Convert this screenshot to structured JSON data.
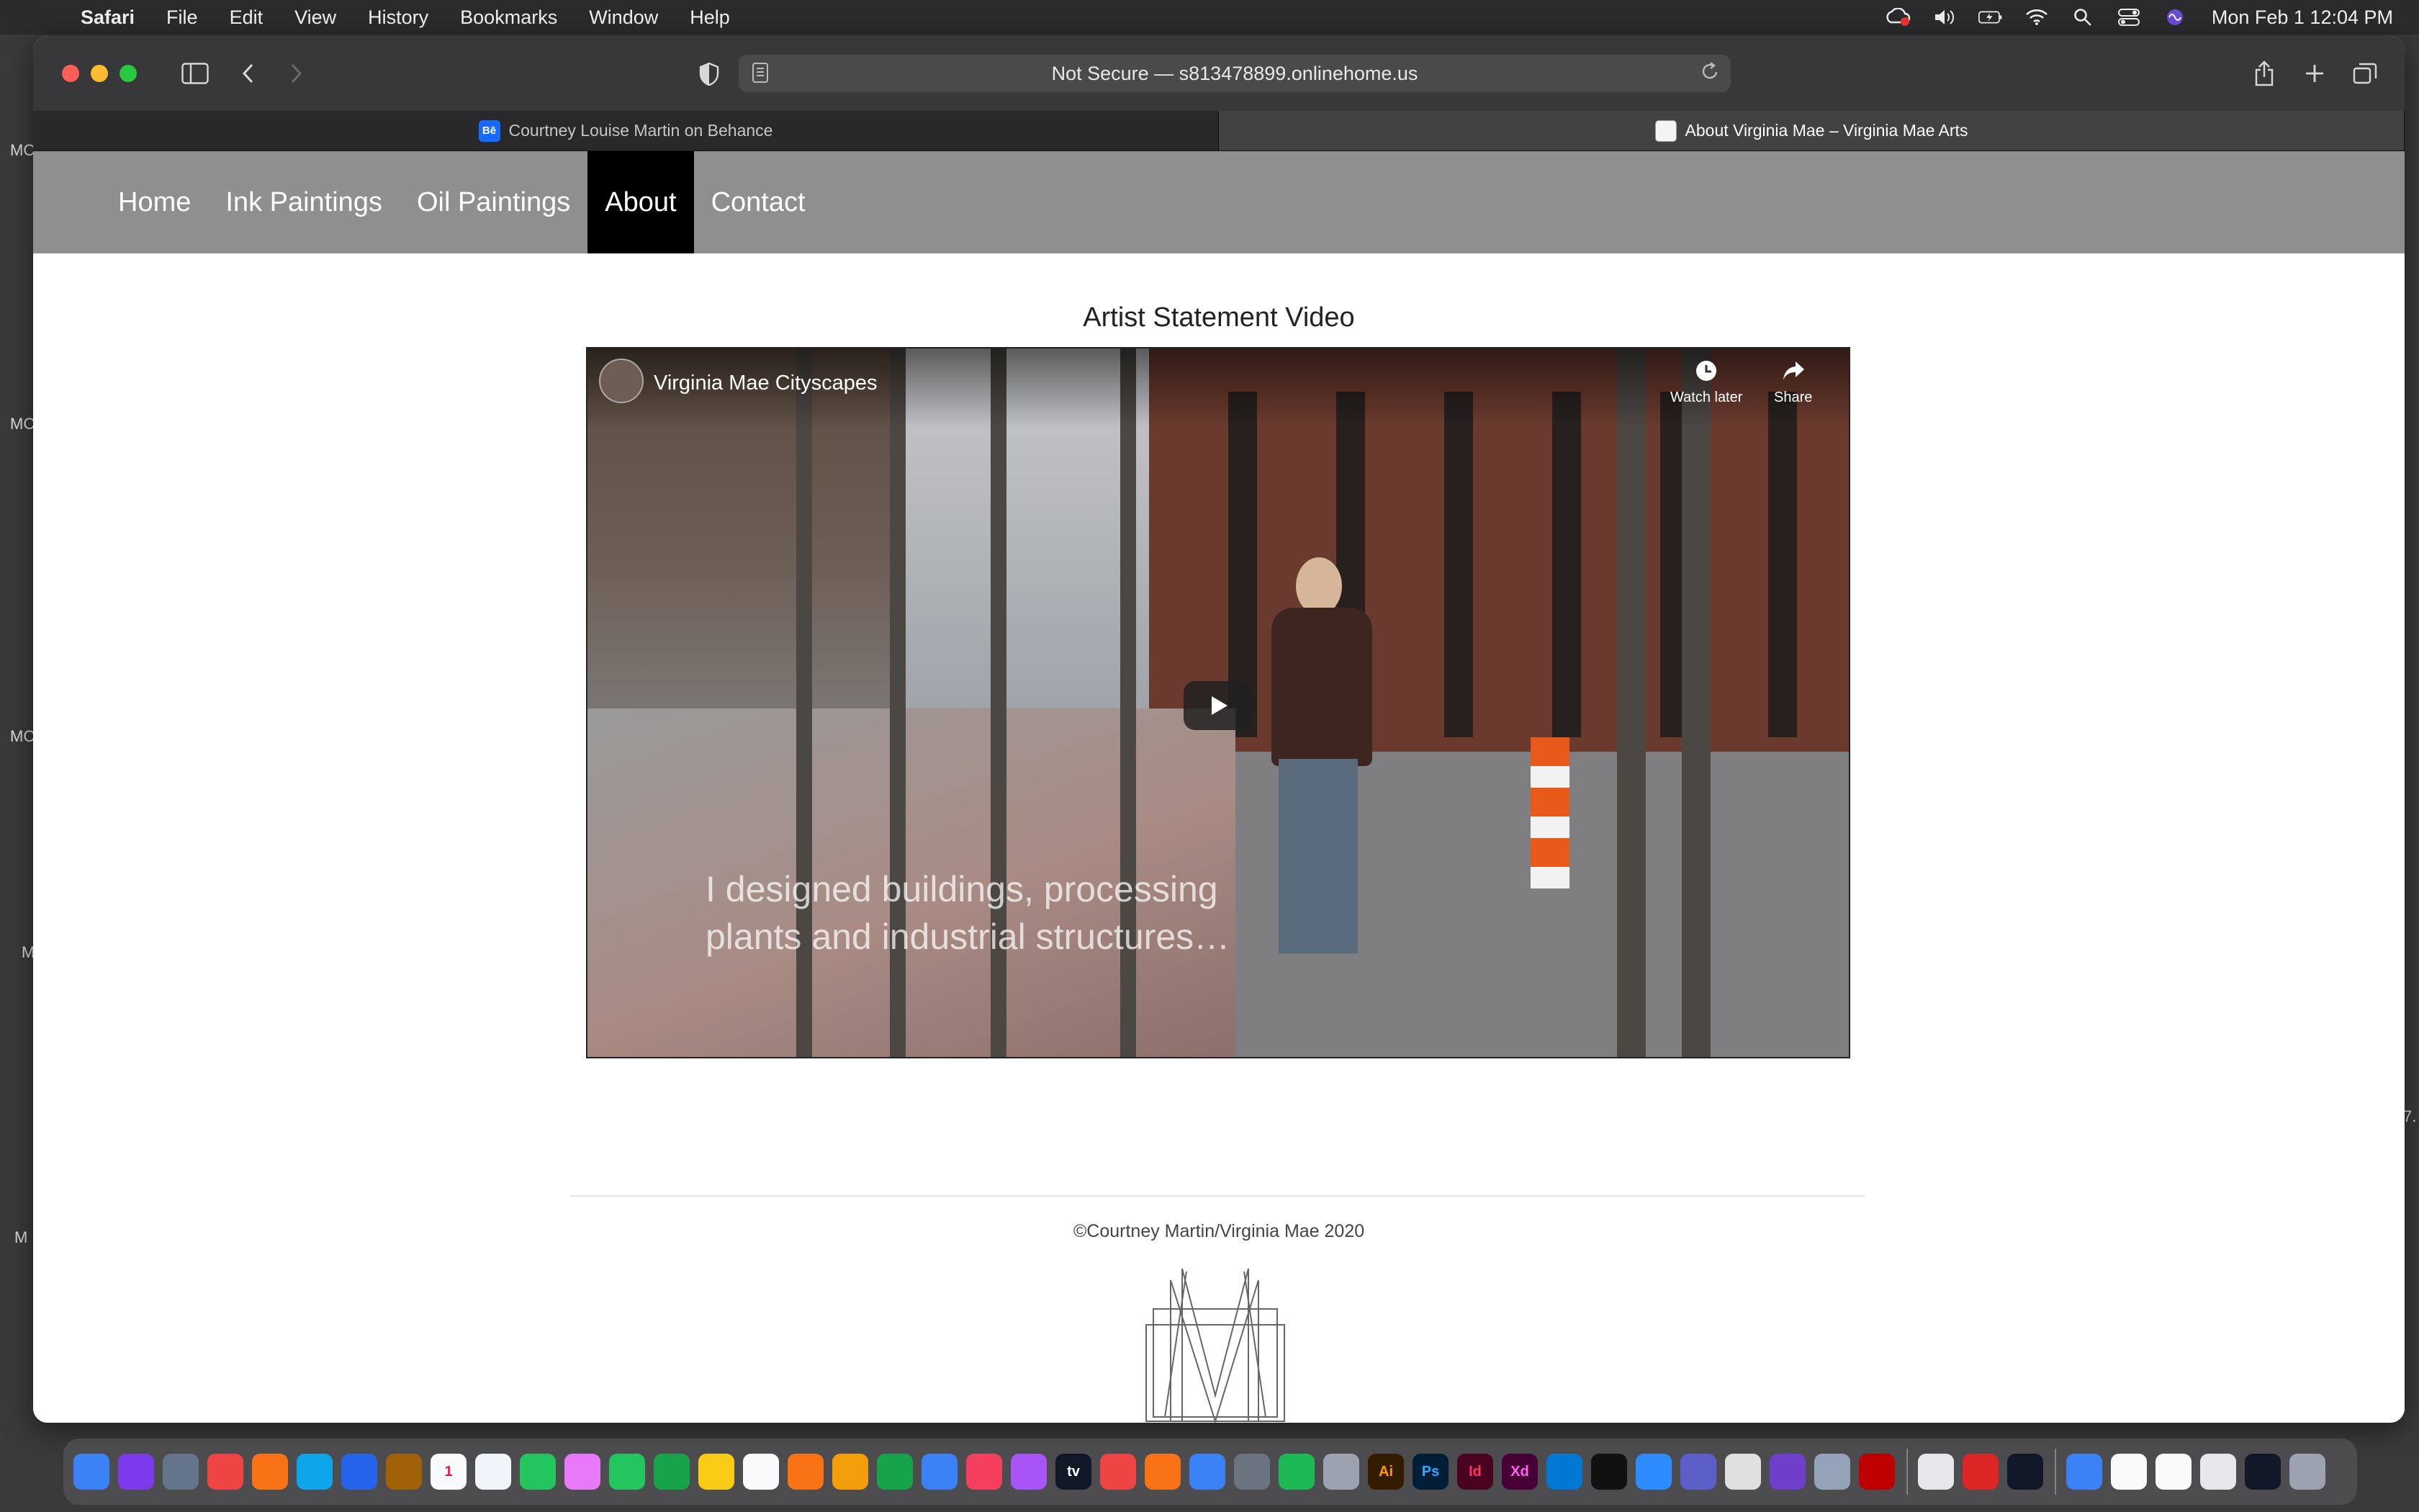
{
  "menubar": {
    "app_name": "Safari",
    "items": [
      "File",
      "Edit",
      "View",
      "History",
      "Bookmarks",
      "Window",
      "Help"
    ],
    "clock": "Mon Feb 1  12:04 PM"
  },
  "browser": {
    "address_text": "Not Secure — s813478899.onlinehome.us",
    "tabs": [
      {
        "label": "Courtney Louise Martin on Behance",
        "favicon_text": "Bē",
        "active": false
      },
      {
        "label": "About Virginia Mae – Virginia Mae Arts",
        "favicon_text": "",
        "active": true
      }
    ]
  },
  "site": {
    "nav": [
      "Home",
      "Ink Paintings",
      "Oil Paintings",
      "About",
      "Contact"
    ],
    "active_nav": "About",
    "section_title": "Artist Statement Video",
    "video": {
      "channel_title": "Virginia Mae Cityscapes",
      "watch_later_label": "Watch later",
      "share_label": "Share",
      "caption_line1": "I designed buildings, processing",
      "caption_line2": "plants and industrial structures…"
    },
    "copyright": "©Courtney Martin/Virginia Mae 2020"
  },
  "desktop_edge_labels": [
    "MC",
    "MC",
    "MC",
    "M",
    "M",
    "7."
  ],
  "dock_icons": [
    "finder-icon",
    "launchpad-icon",
    "app-grid-icon",
    "chrome-icon",
    "firefox-icon",
    "safari-icon",
    "mail-icon",
    "contacts-icon",
    "calendar-icon",
    "reminders-icon",
    "maps-icon",
    "photos-icon",
    "messages-icon",
    "facetime-icon",
    "notes-icon",
    "freeform-icon",
    "vlc-icon",
    "pages-icon",
    "numbers-icon",
    "keynote-icon",
    "music-icon",
    "podcasts-icon",
    "tv-icon",
    "news-icon",
    "books-icon",
    "app-store-icon",
    "system-preferences-icon",
    "spotify-icon",
    "archive-utility-icon",
    "illustrator-icon",
    "photoshop-icon",
    "indesign-icon",
    "xd-icon",
    "vscode-icon",
    "terminal-icon",
    "zoom-icon",
    "teams-icon",
    "slack-icon",
    "github-icon",
    "disk-utility-icon",
    "filezilla-icon",
    "font-book-icon",
    "acrobat-icon",
    "acrobat-reader-icon",
    "downloads-folder-icon",
    "documents-icon",
    "file-icon",
    "mail-attachment-icon",
    "screenshot-icon",
    "trash-icon"
  ],
  "dock_labels": {
    "calendar_day": "1",
    "illustrator": "Ai",
    "photoshop": "Ps",
    "indesign": "Id",
    "xd": "Xd",
    "tv": "tv"
  },
  "colors": {
    "nav_bg": "#8f8f8f",
    "nav_active_bg": "#000000",
    "accent_behance": "#1769ff"
  }
}
